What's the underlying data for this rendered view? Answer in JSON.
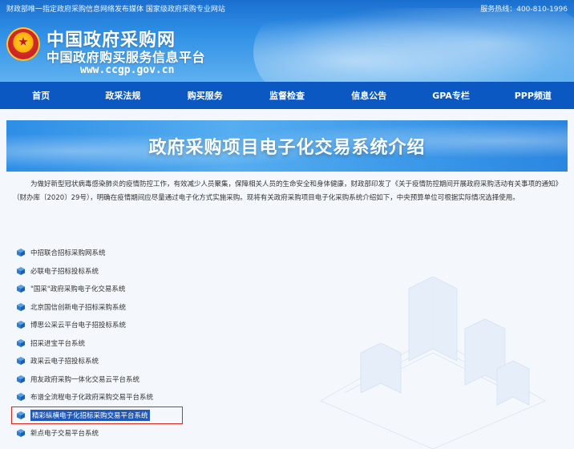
{
  "topbar": {
    "left_text": "财政部唯一指定政府采购信息网络发布媒体 国家级政府采购专业网站",
    "hotline_label": "服务热线：",
    "hotline_number": "400-810-1996"
  },
  "header": {
    "title_main": "中国政府采购网",
    "title_sub": "中国政府购买服务信息平台",
    "url": "www.ccgp.gov.cn",
    "emblem_icon": "national-emblem"
  },
  "nav": {
    "items": [
      "首页",
      "政采法规",
      "购买服务",
      "监督检查",
      "信息公告",
      "GPA专栏",
      "PPP频道"
    ]
  },
  "banner": {
    "title": "政府采购项目电子化交易系统介绍"
  },
  "intro": {
    "text": "为做好新型冠状病毒感染肺炎的疫情防控工作，有效减少人员聚集，保障相关人员的生命安全和身体健康，财政部印发了《关于疫情防控期间开展政府采购活动有关事项的通知》（财办库〔2020〕29号），明确在疫情期间应尽量通过电子化方式实施采购。现将有关政府采购项目电子化采购系统介绍如下，中央预算单位可根据实际情况选择使用。"
  },
  "systems": {
    "bullet_icon": "cube-bullet-icon",
    "items": [
      "中招联合招标采购网系统",
      "必联电子招标投标系统",
      "\"国采\"政府采购电子化交易系统",
      "北京国信创新电子招标采购系统",
      "博思公采云平台电子招投标系统",
      "招采进宝平台系统",
      "政采云电子招投标系统",
      "用友政府采购一体化交易云平台系统",
      "布谱全流程电子化政府采购交易平台系统",
      "精彩纵横电子化招标采购交易平台系统",
      "新点电子交易平台系统"
    ],
    "selected_index": 9
  },
  "colors": {
    "nav_bg": "#0b58c2",
    "highlight_border": "#e0241a",
    "selection_bg": "#1f58b8"
  }
}
